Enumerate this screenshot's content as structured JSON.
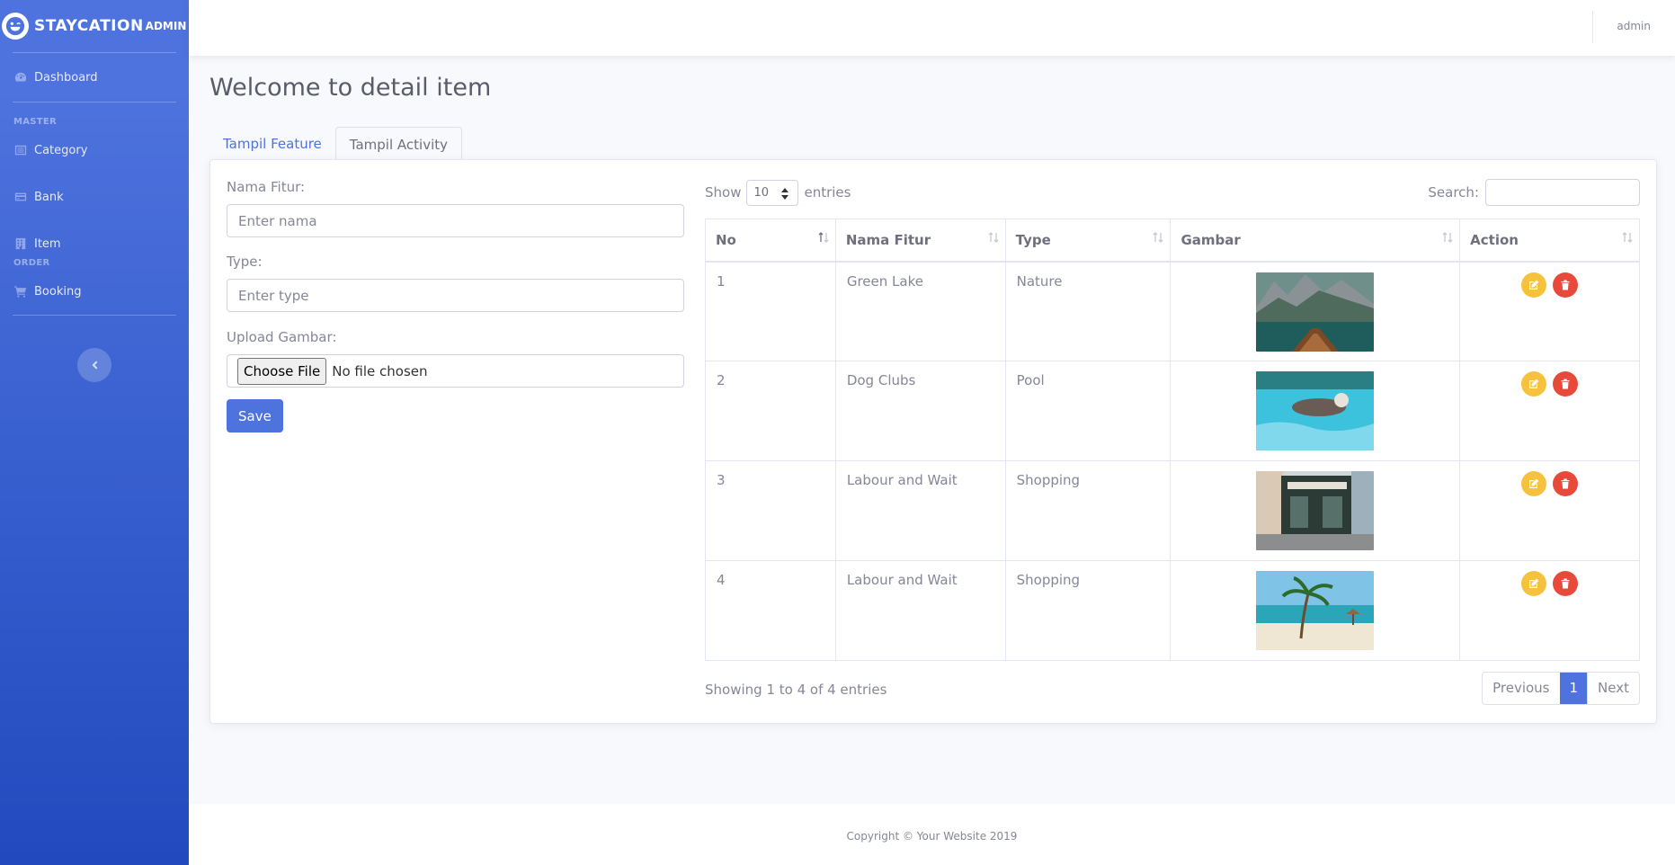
{
  "brand": {
    "name": "STAYCATION",
    "sup": "ADMIN",
    "logo_icon": "laugh-wink-icon"
  },
  "sidebar": {
    "dashboard": "Dashboard",
    "heading_master": "MASTER",
    "category": "Category",
    "bank": "Bank",
    "item": "Item",
    "heading_order": "ORDER",
    "booking": "Booking"
  },
  "topbar": {
    "user": "admin"
  },
  "page": {
    "title": "Welcome to detail item"
  },
  "tabs": [
    {
      "label": "Tampil Feature",
      "active": false
    },
    {
      "label": "Tampil Activity",
      "active": true
    }
  ],
  "form": {
    "nama_label": "Nama Fitur:",
    "nama_placeholder": "Enter nama",
    "type_label": "Type:",
    "type_placeholder": "Enter type",
    "upload_label": "Upload Gambar:",
    "file_button": "Choose File",
    "file_status": "No file chosen",
    "save_label": "Save"
  },
  "datatable": {
    "show_label": "Show",
    "entries_label": "entries",
    "page_length": "10",
    "search_label": "Search:",
    "columns": [
      "No",
      "Nama Fitur",
      "Type",
      "Gambar",
      "Action"
    ],
    "rows": [
      {
        "no": "1",
        "nama": "Green Lake",
        "type": "Nature",
        "image": "lake-boat-image"
      },
      {
        "no": "2",
        "nama": "Dog Clubs",
        "type": "Pool",
        "image": "dog-pool-image"
      },
      {
        "no": "3",
        "nama": "Labour and Wait",
        "type": "Shopping",
        "image": "shop-street-image"
      },
      {
        "no": "4",
        "nama": "Labour and Wait",
        "type": "Shopping",
        "image": "beach-palm-image"
      }
    ],
    "info": "Showing 1 to 4 of 4 entries",
    "pager": {
      "previous": "Previous",
      "current": "1",
      "next": "Next"
    }
  },
  "footer": {
    "copyright": "Copyright © Your Website 2019"
  },
  "colors": {
    "primary": "#4e73df",
    "warning": "#f6c23e",
    "danger": "#e74a3b",
    "text": "#858796"
  }
}
